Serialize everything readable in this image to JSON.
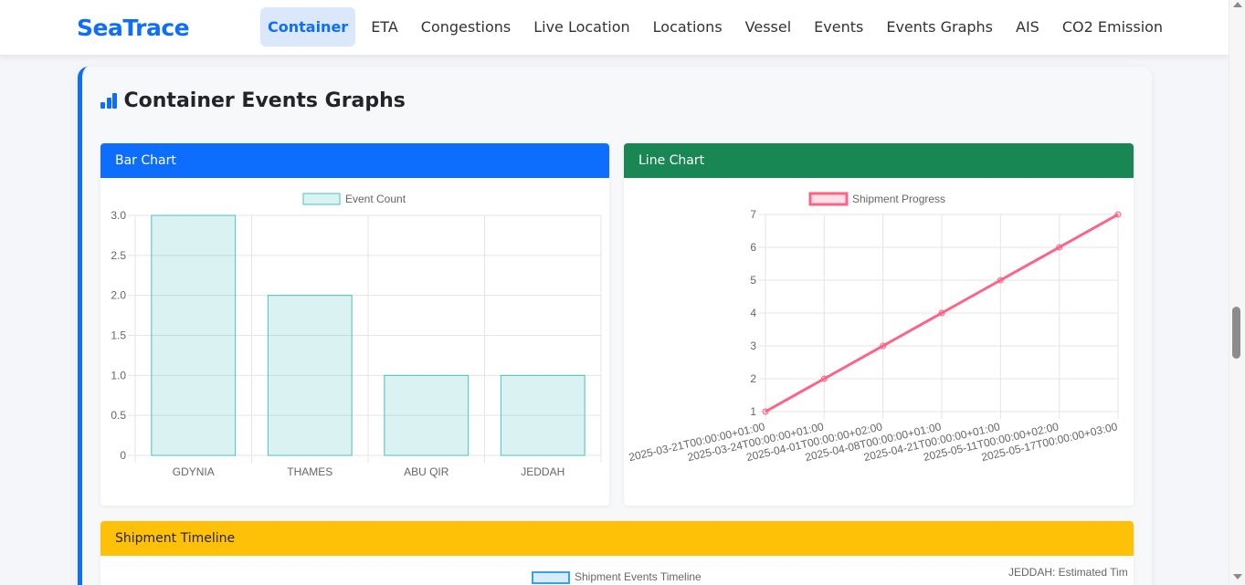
{
  "brand": "SeaTrace",
  "nav": {
    "items": [
      {
        "label": "Container",
        "active": true
      },
      {
        "label": "ETA"
      },
      {
        "label": "Congestions"
      },
      {
        "label": "Live Location"
      },
      {
        "label": "Locations"
      },
      {
        "label": "Vessel"
      },
      {
        "label": "Events"
      },
      {
        "label": "Events Graphs"
      },
      {
        "label": "AIS"
      },
      {
        "label": "CO2 Emission"
      }
    ]
  },
  "page": {
    "title": "Container Events Graphs",
    "title_icon": "bar-chart-icon"
  },
  "panels": {
    "bar": {
      "header": "Bar Chart"
    },
    "line": {
      "header": "Line Chart"
    },
    "timeline": {
      "header": "Shipment Timeline"
    }
  },
  "colors": {
    "primary": "#0d6efd",
    "success": "#198754",
    "warning": "#ffc107",
    "bar_fill": "rgba(75,192,192,0.2)",
    "bar_stroke": "#4bc0c0",
    "line_stroke": "#ff6384",
    "timeline_stroke": "#36a2eb"
  },
  "chart_data": [
    {
      "type": "bar",
      "title": "",
      "categories": [
        "GDYNIA",
        "THAMES",
        "ABU QIR",
        "JEDDAH"
      ],
      "series": [
        {
          "name": "Event Count",
          "values": [
            3,
            2,
            1,
            1
          ]
        }
      ],
      "ylim": [
        0,
        3
      ],
      "yticks": [
        "0",
        "0.5",
        "1.0",
        "1.5",
        "2.0",
        "2.5",
        "3.0"
      ],
      "grid": true,
      "legend": "top"
    },
    {
      "type": "line",
      "title": "",
      "x": [
        "2025-03-21T00:00:00+01:00",
        "2025-03-24T00:00:00+01:00",
        "2025-04-01T00:00:00+02:00",
        "2025-04-08T00:00:00+01:00",
        "2025-04-21T00:00:00+01:00",
        "2025-05-11T00:00:00+02:00",
        "2025-05-17T00:00:00+03:00"
      ],
      "series": [
        {
          "name": "Shipment Progress",
          "values": [
            1,
            2,
            3,
            4,
            5,
            6,
            7
          ]
        }
      ],
      "ylim": [
        1,
        7
      ],
      "yticks": [
        "1",
        "2",
        "3",
        "4",
        "5",
        "6",
        "7"
      ],
      "grid": true,
      "legend": "top"
    },
    {
      "type": "scatter",
      "title": "",
      "series": [
        {
          "name": "Shipment Events Timeline",
          "values": []
        }
      ],
      "annotation": "JEDDAH: Estimated Tim",
      "legend": "top"
    }
  ]
}
